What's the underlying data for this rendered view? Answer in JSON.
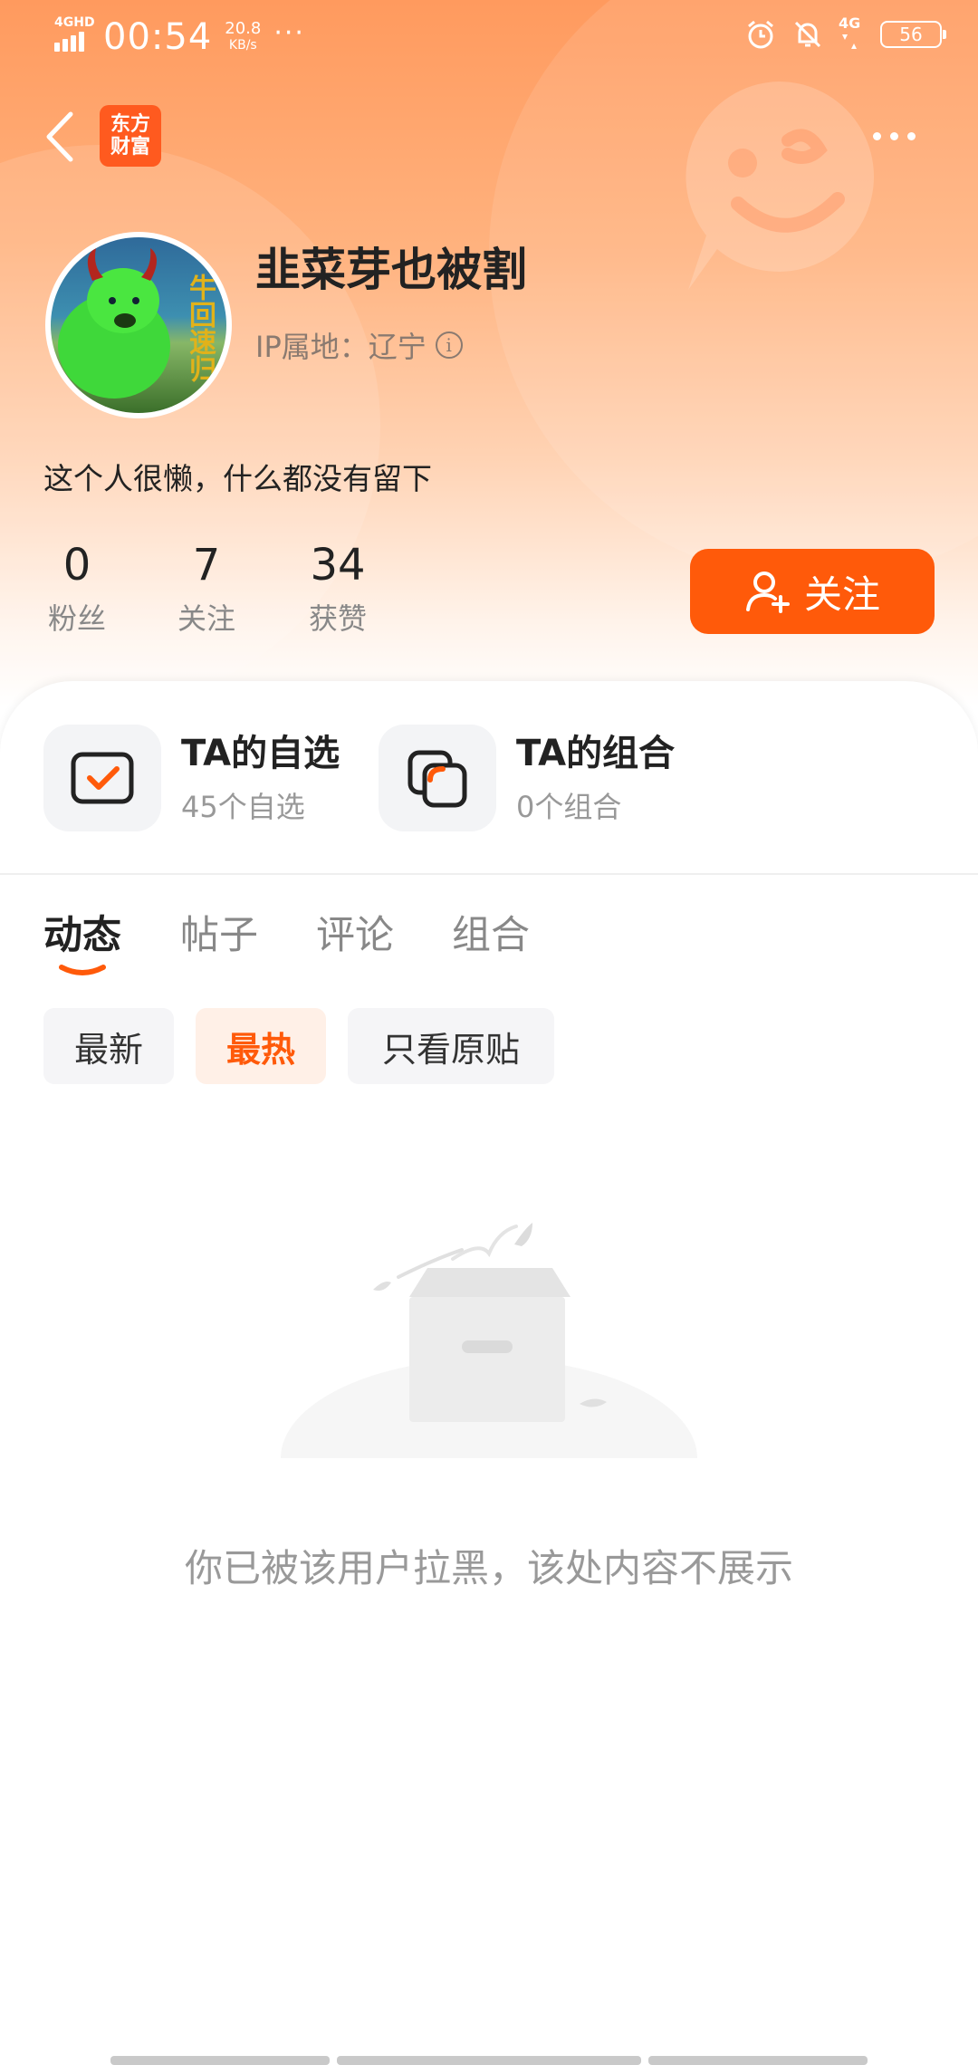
{
  "status_bar": {
    "network": "4GHD",
    "time": "00:54",
    "speed_value": "20.8",
    "speed_unit": "KB/s",
    "more": "···",
    "network_right": "4G",
    "battery": "56"
  },
  "nav": {
    "app_logo_line1": "东方",
    "app_logo_line2": "财富"
  },
  "profile": {
    "username": "韭菜芽也被割",
    "ip_location": "IP属地：辽宁",
    "bio": "这个人很懒，什么都没有留下",
    "avatar_text": "牛回速归",
    "stats": [
      {
        "value": "0",
        "label": "粉丝"
      },
      {
        "value": "7",
        "label": "关注"
      },
      {
        "value": "34",
        "label": "获赞"
      }
    ],
    "follow_label": "关注"
  },
  "cards": [
    {
      "title": "TA的自选",
      "subtitle": "45个自选"
    },
    {
      "title": "TA的组合",
      "subtitle": "0个组合"
    }
  ],
  "tabs": [
    {
      "label": "动态",
      "active": true
    },
    {
      "label": "帖子",
      "active": false
    },
    {
      "label": "评论",
      "active": false
    },
    {
      "label": "组合",
      "active": false
    }
  ],
  "filters": [
    {
      "label": "最新",
      "active": false
    },
    {
      "label": "最热",
      "active": true
    },
    {
      "label": "只看原贴",
      "active": false
    }
  ],
  "empty_state": {
    "message": "你已被该用户拉黑，该处内容不展示"
  },
  "colors": {
    "accent": "#ff5a0a",
    "header_gradient_top": "#ff9a5e",
    "text_primary": "#222222",
    "text_secondary": "#999999"
  }
}
